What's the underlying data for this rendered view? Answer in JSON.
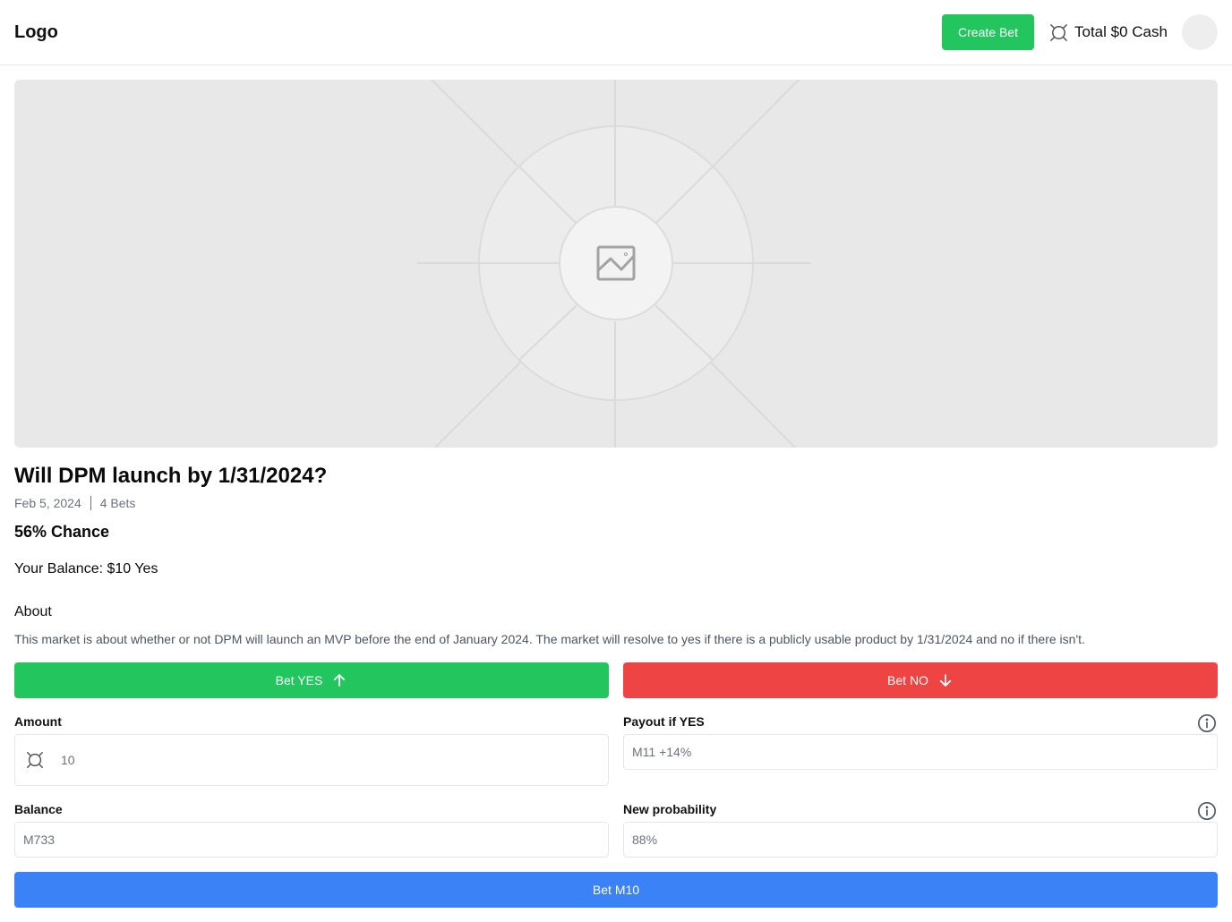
{
  "header": {
    "logo": "Logo",
    "create_bet_label": "Create Bet",
    "cash_label": "Total $0 Cash",
    "cash_icon": "coin-icon"
  },
  "hero": {
    "icon": "image-placeholder-icon"
  },
  "market": {
    "title": "Will DPM launch by 1/31/2024?",
    "date": "Feb 5, 2024",
    "bets": "4 Bets",
    "chance": "56% Chance",
    "your_balance": "Your Balance: $10 Yes",
    "about_title": "About",
    "about_text": "This market is about whether or not DPM will launch an MVP before the end of January 2024. The market will resolve to yes if there is a publicly usable product by 1/31/2024 and no if there isn't."
  },
  "actions": {
    "bet_yes_label": "Bet YES",
    "bet_no_label": "Bet NO",
    "submit_label": "Bet M10"
  },
  "form": {
    "amount_label": "Amount",
    "amount_value": "10",
    "payout_label": "Payout if YES",
    "payout_value": "M11 +14%",
    "balance_label": "Balance",
    "balance_value": "M733",
    "probability_label": "New probability",
    "probability_value": "88%"
  },
  "colors": {
    "green": "#22c55e",
    "red": "#ef4444",
    "blue": "#3b82f6",
    "border": "#e5e7eb",
    "muted_text": "#6b7280"
  }
}
